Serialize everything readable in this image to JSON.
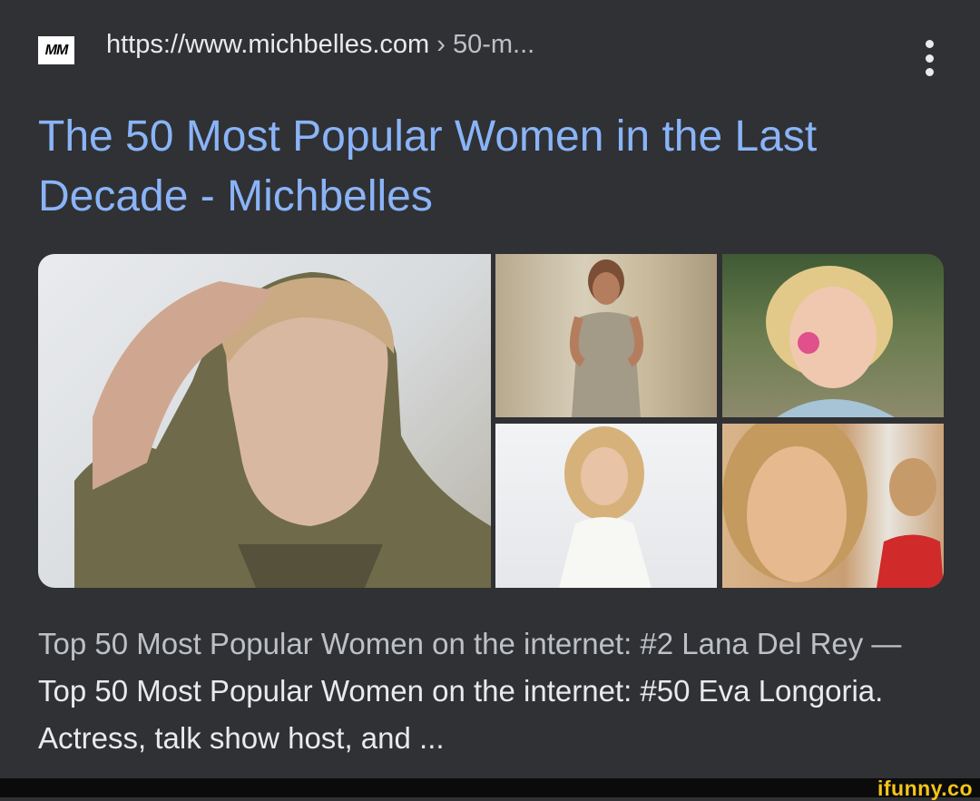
{
  "result": {
    "favicon_text": "MM",
    "url_domain": "https://www.michbelles.com",
    "url_path": " › 50-m...",
    "menu_icon": "more-vert-icon",
    "title": "The 50 Most Popular Women in the Last Decade - Michbelles",
    "images": [
      {
        "name": "photo-man-hand-in-hair"
      },
      {
        "name": "photo-woman-sequin-gown"
      },
      {
        "name": "photo-woman-flower-smile"
      },
      {
        "name": "photo-woman-white-dress"
      },
      {
        "name": "photo-woman-red-carpet"
      }
    ],
    "snippet_lead": "Top 50 Most Popular Women on the internet: #2 Lana Del Rey — ",
    "snippet_body": "Top 50 Most Popular Women on the internet: #50 Eva Longoria. Actress, talk show host, and ..."
  },
  "watermark": "ifunny.co",
  "colors": {
    "background": "#303134",
    "link": "#8ab4f8",
    "text": "#e8eaed",
    "muted": "#bdc1c6",
    "watermark": "#f5c518"
  }
}
